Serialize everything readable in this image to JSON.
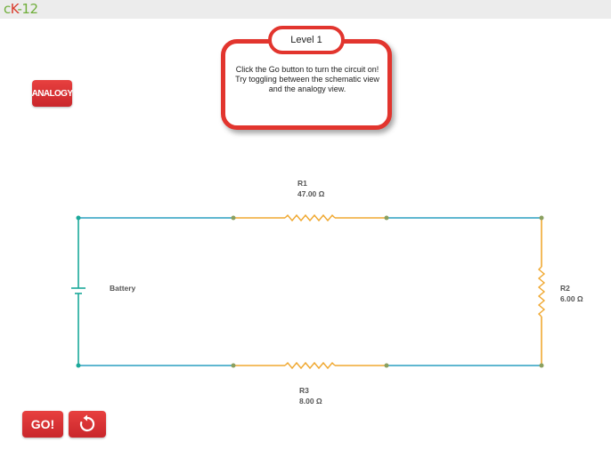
{
  "app": {
    "logo": {
      "c": "c",
      "k": "K",
      "n": "-12"
    }
  },
  "colors": {
    "accent": "#e2352e",
    "wire": "#2a9fc0",
    "resistor": "#f0a830",
    "battery": "#1ba89a"
  },
  "toolbar": {
    "analogy_label": "ANALOGY",
    "go_label": "GO!",
    "reset_icon": "reset-icon"
  },
  "dialog": {
    "title": "Level 1",
    "text": "Click the Go button to turn the circuit on! Try toggling between the schematic view and the analogy view."
  },
  "circuit": {
    "battery": {
      "label": "Battery"
    },
    "r1": {
      "name": "R1",
      "value": "47.00 Ω"
    },
    "r2": {
      "name": "R2",
      "value": "6.00 Ω"
    },
    "r3": {
      "name": "R3",
      "value": "8.00 Ω"
    }
  }
}
